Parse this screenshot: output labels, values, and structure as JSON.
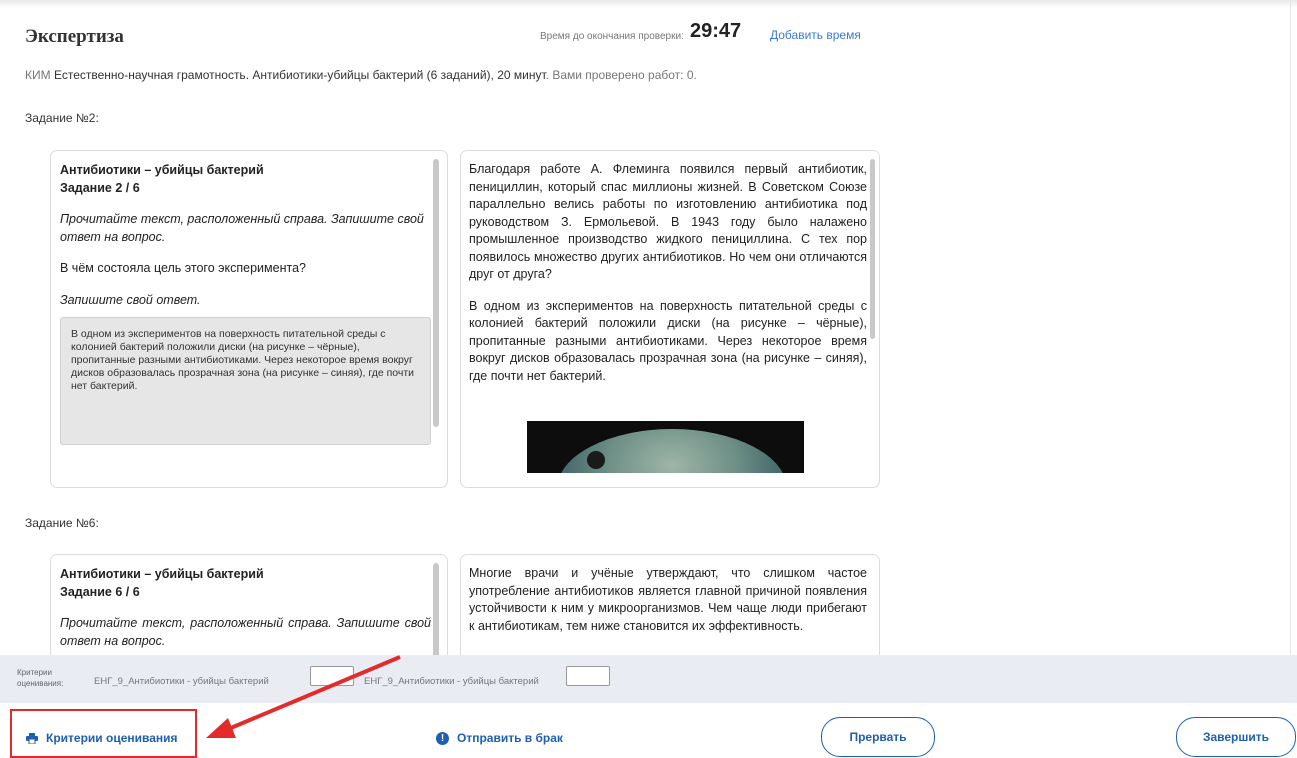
{
  "header": {
    "title": "Экспертиза",
    "timer_label": "Время до окончания проверки:",
    "timer_value": "29:47",
    "add_time": "Добавить время"
  },
  "kim": {
    "prefix": "КИМ",
    "name": "Естественно-научная грамотность. Антибиотики-убийцы бактерий (6 заданий), 20 минут",
    "checked": ". Вами проверено работ: 0."
  },
  "task2": {
    "heading": "Задание №2:",
    "title": "Антибиотики – убийцы бактерий",
    "subtitle": "Задание 2 / 6",
    "instruction": "Прочитайте текст, расположенный справа. Запишите свой ответ на вопрос.",
    "question": "В чём состояла цель этого эксперимента?",
    "answer_prompt": "Запишите свой ответ.",
    "answer": "В одном из экспериментов на поверхность питательной среды с колонией бактерий положили диски (на рисунке – чёрные), пропитанные разными антибиотиками. Через некоторое время вокруг дисков образовалась прозрачная зона (на рисунке – синяя), где почти нет бактерий.",
    "text_p1": "Благодаря работе А. Флеминга появился первый антибиотик, пенициллин, который спас миллионы жизней. В Советском Союзе параллельно велись работы по изготовлению антибиотика под руководством З. Ермольевой. В 1943 году было налажено промышленное производство жидкого пенициллина. С тех пор появилось множество других антибиотиков. Но чем они отличаются друг от друга?",
    "text_p2": "В одном из экспериментов на поверхность питательной среды с колонией бактерий положили диски (на рисунке – чёрные), пропитанные разными антибиотиками. Через некоторое время вокруг дисков образовалась прозрачная зона (на рисунке – синяя), где почти нет бактерий."
  },
  "task6": {
    "heading": "Задание №6:",
    "title": "Антибиотики – убийцы бактерий",
    "subtitle": "Задание 6 / 6",
    "instruction": "Прочитайте текст, расположенный справа. Запишите свой ответ на вопрос.",
    "text_p1": "Многие врачи и учёные утверждают, что слишком частое употребление антибиотиков является главной причиной появления устойчивости к ним у микроорганизмов. Чем чаще люди прибегают к антибиотикам, тем ниже становится их эффективность."
  },
  "criteria": {
    "label": "Критерии оценивания:",
    "item1": "ЕНГ_9_Антибиотики - убийцы бактерий",
    "item2": "ЕНГ_9_Антибиотики - убийцы бактерий",
    "value1": "",
    "value2": ""
  },
  "footer": {
    "criteria_link": "Критерии оценивания",
    "reject_link": "Отправить в брак",
    "abort_button": "Прервать",
    "finish_button": "Завершить"
  },
  "icons": {
    "printer": "printer-icon",
    "alert": "alert-icon"
  },
  "colors": {
    "accent": "#1f5fb3",
    "highlight": "#e32b2b",
    "criteria_bg": "#e9edf3"
  }
}
